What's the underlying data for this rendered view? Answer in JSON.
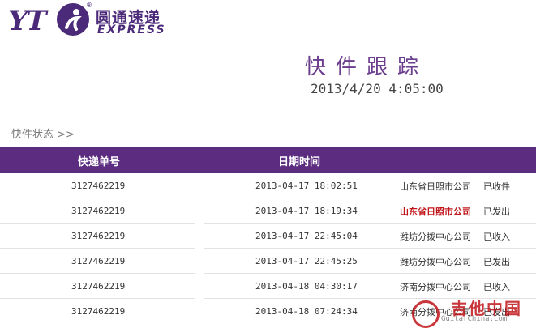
{
  "header": {
    "logo": {
      "mark": "YT",
      "name_cn": "圆通速递",
      "name_en": "EXPRESS",
      "registered": "®"
    },
    "title": "快件跟踪",
    "datetime": "2013/4/20 4:05:00"
  },
  "status_link": "快件状态 >>",
  "table": {
    "headers": [
      "快递单号",
      "日期时间"
    ],
    "rows": [
      {
        "number": "3127462219",
        "time": "2013-04-17 18:02:51",
        "place": "山东省日照市公司",
        "action": "已收件",
        "highlight": false
      },
      {
        "number": "3127462219",
        "time": "2013-04-17 18:19:34",
        "place": "山东省日照市公司",
        "action": "已发出",
        "highlight": true
      },
      {
        "number": "3127462219",
        "time": "2013-04-17 22:45:04",
        "place": "潍坊分拨中心公司",
        "action": "已收入",
        "highlight": false
      },
      {
        "number": "3127462219",
        "time": "2013-04-17 22:45:25",
        "place": "潍坊分拨中心公司",
        "action": "已发出",
        "highlight": false
      },
      {
        "number": "3127462219",
        "time": "2013-04-18 04:30:17",
        "place": "济南分拨中心公司",
        "action": "已收入",
        "highlight": false
      },
      {
        "number": "3127462219",
        "time": "2013-04-18 07:24:34",
        "place": "济南分拨中心公司",
        "action": "已发出",
        "highlight": false
      }
    ]
  },
  "watermark": {
    "cn": "吉他中国",
    "en": "GuitarChina.com"
  },
  "colors": {
    "brand": "#5b2c80",
    "highlight": "#c0161b"
  }
}
